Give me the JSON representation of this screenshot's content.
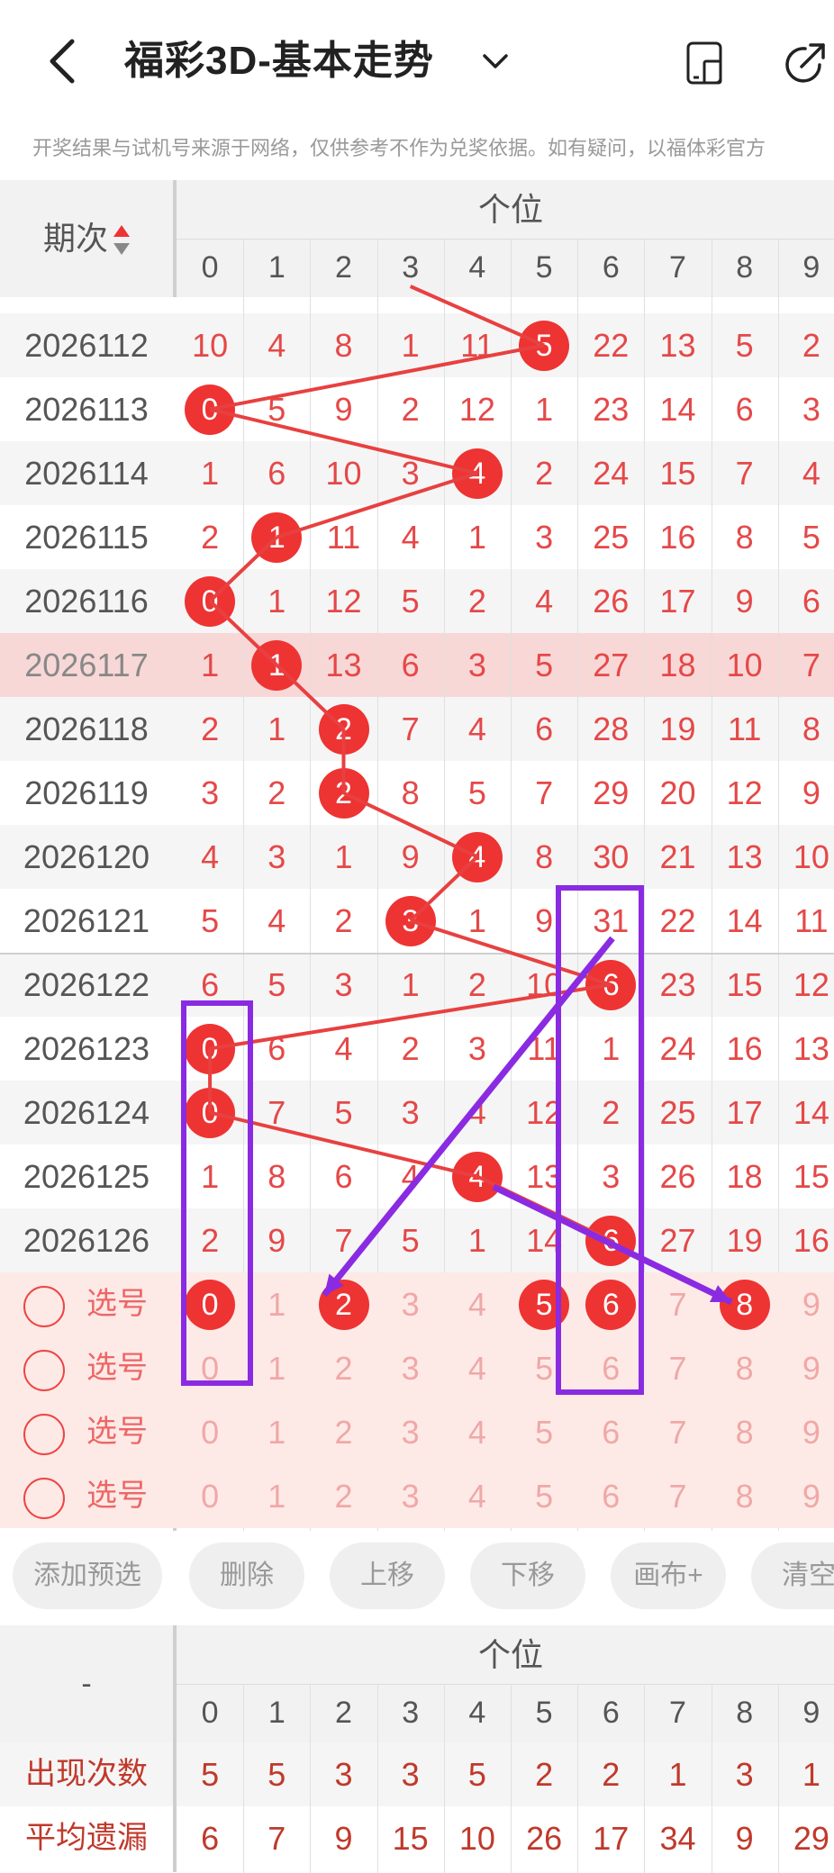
{
  "header": {
    "title": "福彩3D-基本走势",
    "disclaimer": "开奖结果与试机号来源于网络，仅供参考不作为兑奖依据。如有疑问，以福体彩官方"
  },
  "table": {
    "period_header": "期次",
    "group_header": "个位",
    "digits": [
      "0",
      "1",
      "2",
      "3",
      "4",
      "5",
      "6",
      "7",
      "8",
      "9"
    ],
    "rows": [
      {
        "period": "2026112",
        "values": [
          "10",
          "4",
          "8",
          "1",
          "11",
          "5",
          "22",
          "13",
          "5",
          "2"
        ],
        "hit": 5,
        "highlight": false
      },
      {
        "period": "2026113",
        "values": [
          "0",
          "5",
          "9",
          "2",
          "12",
          "1",
          "23",
          "14",
          "6",
          "3"
        ],
        "hit": 0,
        "highlight": false
      },
      {
        "period": "2026114",
        "values": [
          "1",
          "6",
          "10",
          "3",
          "4",
          "2",
          "24",
          "15",
          "7",
          "4"
        ],
        "hit": 4,
        "highlight": false
      },
      {
        "period": "2026115",
        "values": [
          "2",
          "1",
          "11",
          "4",
          "1",
          "3",
          "25",
          "16",
          "8",
          "5"
        ],
        "hit": 1,
        "highlight": false
      },
      {
        "period": "2026116",
        "values": [
          "0",
          "1",
          "12",
          "5",
          "2",
          "4",
          "26",
          "17",
          "9",
          "6"
        ],
        "hit": 0,
        "highlight": false
      },
      {
        "period": "2026117",
        "values": [
          "1",
          "1",
          "13",
          "6",
          "3",
          "5",
          "27",
          "18",
          "10",
          "7"
        ],
        "hit": 1,
        "highlight": true
      },
      {
        "period": "2026118",
        "values": [
          "2",
          "1",
          "2",
          "7",
          "4",
          "6",
          "28",
          "19",
          "11",
          "8"
        ],
        "hit": 2,
        "highlight": false
      },
      {
        "period": "2026119",
        "values": [
          "3",
          "2",
          "2",
          "8",
          "5",
          "7",
          "29",
          "20",
          "12",
          "9"
        ],
        "hit": 2,
        "highlight": false
      },
      {
        "period": "2026120",
        "values": [
          "4",
          "3",
          "1",
          "9",
          "4",
          "8",
          "30",
          "21",
          "13",
          "10"
        ],
        "hit": 4,
        "highlight": false
      },
      {
        "period": "2026121",
        "values": [
          "5",
          "4",
          "2",
          "3",
          "1",
          "9",
          "31",
          "22",
          "14",
          "11"
        ],
        "hit": 3,
        "highlight": false
      },
      {
        "period": "2026122",
        "values": [
          "6",
          "5",
          "3",
          "1",
          "2",
          "10",
          "6",
          "23",
          "15",
          "12"
        ],
        "hit": 6,
        "highlight": false
      },
      {
        "period": "2026123",
        "values": [
          "0",
          "6",
          "4",
          "2",
          "3",
          "11",
          "1",
          "24",
          "16",
          "13"
        ],
        "hit": 0,
        "highlight": false
      },
      {
        "period": "2026124",
        "values": [
          "0",
          "7",
          "5",
          "3",
          "4",
          "12",
          "2",
          "25",
          "17",
          "14"
        ],
        "hit": 0,
        "highlight": false
      },
      {
        "period": "2026125",
        "values": [
          "1",
          "8",
          "6",
          "4",
          "4",
          "13",
          "3",
          "26",
          "18",
          "15"
        ],
        "hit": 4,
        "highlight": false
      },
      {
        "period": "2026126",
        "values": [
          "2",
          "9",
          "7",
          "5",
          "1",
          "14",
          "6",
          "27",
          "19",
          "16"
        ],
        "hit": 6,
        "highlight": false
      }
    ],
    "select_rows": [
      {
        "label": "选号",
        "selected": [
          0,
          2,
          5,
          6,
          8
        ]
      },
      {
        "label": "选号",
        "selected": []
      },
      {
        "label": "选号",
        "selected": []
      },
      {
        "label": "选号",
        "selected": []
      }
    ]
  },
  "actions": [
    "添加预选",
    "删除",
    "上移",
    "下移",
    "画布+",
    "清空"
  ],
  "stats": {
    "corner": "-",
    "group_header": "个位",
    "digits": [
      "0",
      "1",
      "2",
      "3",
      "4",
      "5",
      "6",
      "7",
      "8",
      "9"
    ],
    "rows": [
      {
        "label": "出现次数",
        "values": [
          "5",
          "5",
          "3",
          "3",
          "5",
          "2",
          "2",
          "1",
          "3",
          "1"
        ]
      },
      {
        "label": "平均遗漏",
        "values": [
          "6",
          "7",
          "9",
          "15",
          "10",
          "26",
          "17",
          "34",
          "9",
          "29"
        ]
      }
    ]
  },
  "colors": {
    "accent": "#ee3333",
    "annotation": "#8a2be2",
    "highlight_row": "#f8d7d7",
    "select_bg": "#fdeae6"
  }
}
